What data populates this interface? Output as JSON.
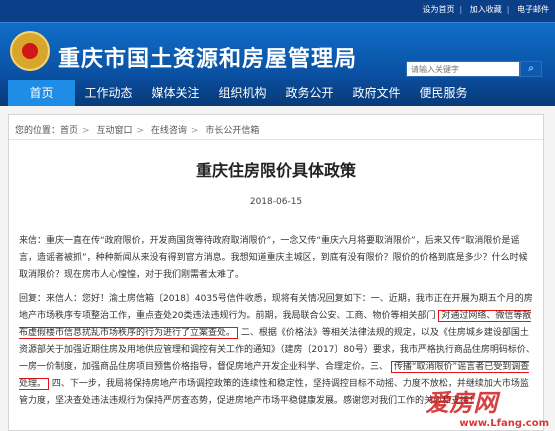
{
  "toplinks": [
    "设为首页",
    "加入收藏",
    "电子邮件"
  ],
  "site_title": "重庆市国土资源和房屋管理局",
  "search": {
    "placeholder": "请输入关键字",
    "button_icon": "search-icon"
  },
  "nav": [
    "首页",
    "工作动态",
    "媒体关注",
    "组织机构",
    "政务公开",
    "政府文件",
    "便民服务"
  ],
  "breadcrumb": [
    "您的位置：首页",
    "互动窗口",
    "在线咨询",
    "市长公开信箱"
  ],
  "page_title": "重庆住房限价具体政策",
  "date": "2018-06-15",
  "letter": "来信：重庆一直在传“政府限价，开发商国货等待政府取消限价”，一念又传“重庆六月将要取消限价”，后来又传“取消限价是谣言，造谣者被抓”，种种新闻从来没有得到官方消息。我想知道重庆主城区，到底有没有限价？限价的价格到底是多少？什么时候取消限价？现在房市人心惶惶，对于我们刚需者太难了。",
  "reply": {
    "p1": "回复：来信人：您好！渝土房信箱〔2018〕4035号信件收悉，现将有关情况回复如下：一、近期，我市正在开展为期五个月的房地产市场秩序专项整治工作，重点查处20类违法违规行为。前期，我局联合公安、工商、物价等相关部门",
    "m1": "对通过网络、微信等散布虚假楼市信息扰乱市场秩序的行为进行了立案查处。",
    "p2": "二、根据《价格法》等相关法律法规的规定，以及《住房城乡建设部国土资源部关于加强近期住房及用地供应管理和调控有关工作的通知》（建房〔2017〕80号）要求，我市严格执行商品住房明码标价、一房一价制度，加强商品住房项目预售价格指导，督促房地产开发企业科学、合理定价。三、",
    "m2": "传播“取消限价”谣言者已受到调查处理。",
    "p3": "四、下一步，我局将保持房地产市场调控政策的连续性和稳定性，坚持调控目标不动摇、力度不放松，并继续加大市场监管力度，坚决查处违法违规行为保持严厉查态势，促进房地产市场平稳健康发展。感谢您对我们工作的关心和支持！"
  },
  "watermark": {
    "logo": "爱房网",
    "url": "www.Lfang.com"
  },
  "colors": {
    "nav_bg": "#083a77",
    "header_bg": "#0a4d9e",
    "mark": "#e11111"
  }
}
